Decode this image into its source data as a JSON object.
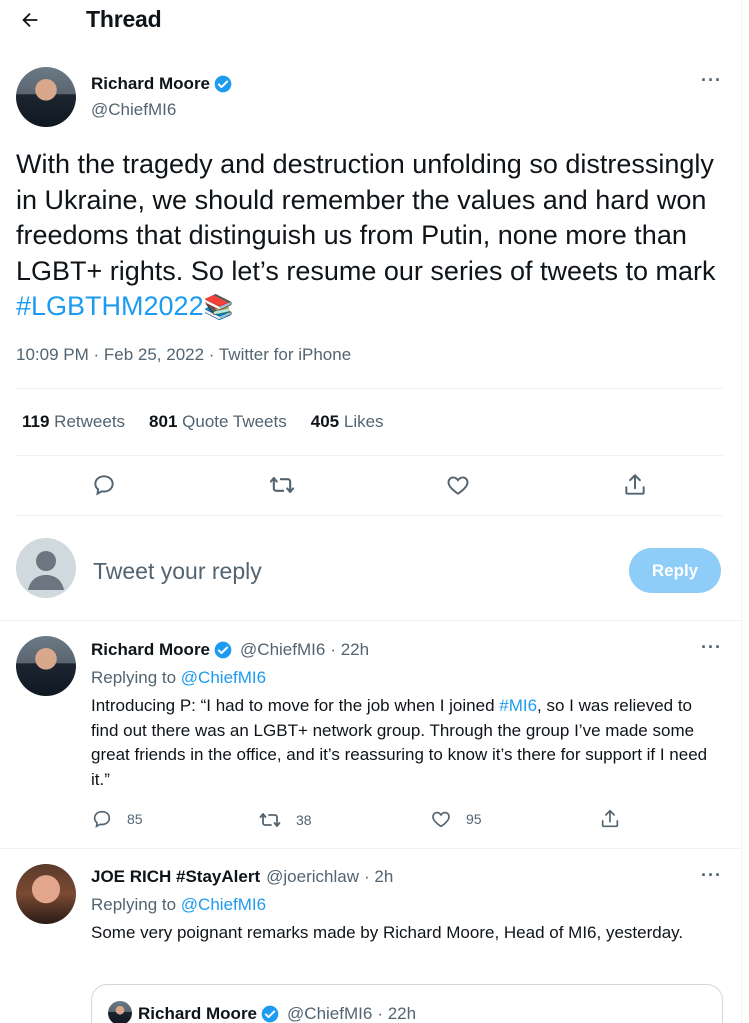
{
  "header": {
    "title": "Thread",
    "back_icon": "arrow-left-icon"
  },
  "main_tweet": {
    "author_name": "Richard Moore",
    "author_handle": "@ChiefMI6",
    "text_before": "With the tragedy and destruction unfolding so distressingly in Ukraine, we should remember the values and hard won freedoms that distinguish us from Putin, none more than LGBT+ rights. So let’s resume our series of tweets to mark ",
    "hashtag": "#LGBTHM2022",
    "emoji": "📚",
    "timestamp": "10:09 PM · Feb 25, 2022 · Twitter for iPhone",
    "stats": {
      "retweets_count": "119",
      "retweets_label": "Retweets",
      "quotes_count": "801",
      "quotes_label": "Quote Tweets",
      "likes_count": "405",
      "likes_label": "Likes"
    }
  },
  "reply_composer": {
    "placeholder": "Tweet your reply",
    "button_label": "Reply"
  },
  "reply1": {
    "author_name": "Richard Moore",
    "author_handle": "@ChiefMI6",
    "time": "· 22h",
    "replying_prefix": "Replying to",
    "replying_handle": "@ChiefMI6",
    "text_part1": "Introducing P: “I had to move for the job when I joined ",
    "text_hashtag": "#MI6",
    "text_part2": ", so I was relieved to find out there was an LGBT+ network group. Through the group I’ve made some great friends in the office, and it’s reassuring to know it’s there for support if I need it.”",
    "reply_count": "85",
    "retweet_count": "38",
    "like_count": "95"
  },
  "reply2": {
    "author_name": "JOE RICH #StayAlert",
    "author_handle": "@joerichlaw",
    "time": "· 2h",
    "replying_prefix": "Replying to",
    "replying_handle": "@ChiefMI6",
    "text": "Some very poignant remarks made by Richard Moore, Head of MI6, yesterday.",
    "quote": {
      "author_name": "Richard Moore",
      "author_handle": "@ChiefMI6",
      "time": "· 22h"
    }
  },
  "colors": {
    "accent": "#1d9bf0",
    "muted": "#536471",
    "reply_button": "#8ecdf7",
    "text": "#0f1419"
  }
}
